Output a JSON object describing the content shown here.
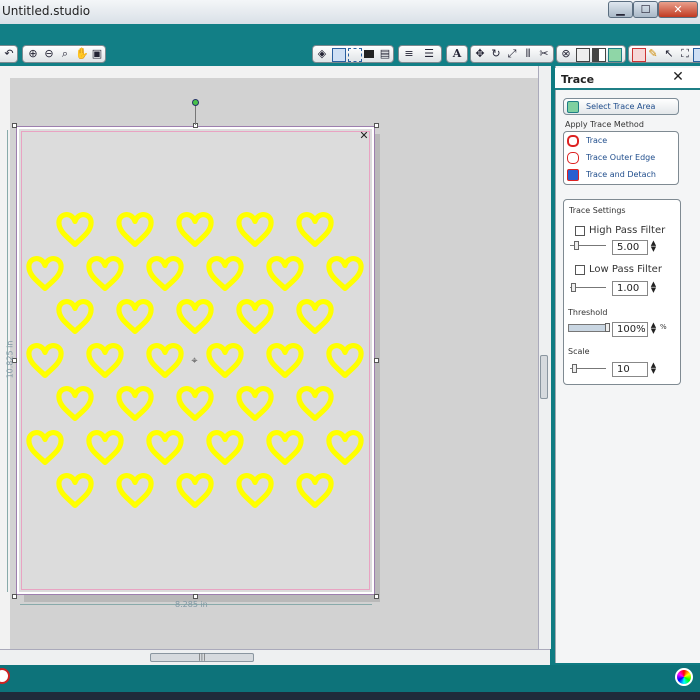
{
  "window": {
    "title": "Untitled.studio",
    "min_symbol": "▁",
    "max_symbol": "☐",
    "close_symbol": "✕"
  },
  "document": {
    "height_label": "10.825 in",
    "width_label": "8.285 in",
    "pattern_color": "#ffff00",
    "page_close_symbol": "✕",
    "center_symbol": "⌖"
  },
  "toolbar": {
    "zoom_in_icon": "⊕",
    "zoom_out_icon": "⊖",
    "zoom_select_icon": "⌕",
    "pan_icon": "✋",
    "fit_icon": "▣",
    "text_icon": "A",
    "pencil_icon": "✎",
    "cursor_icon": "↖"
  },
  "trace_panel": {
    "title": "Trace",
    "close_symbol": "✕",
    "select_trace_area_label": "Select Trace Area",
    "apply_trace_method_label": "Apply Trace Method",
    "methods": [
      {
        "label": "Trace"
      },
      {
        "label": "Trace Outer Edge"
      },
      {
        "label": "Trace and Detach"
      }
    ],
    "trace_settings_label": "Trace Settings",
    "high_pass": {
      "label": "High Pass Filter",
      "checked": false,
      "value": "5.00"
    },
    "low_pass": {
      "label": "Low Pass Filter",
      "checked": false,
      "value": "1.00"
    },
    "threshold": {
      "label": "Threshold",
      "value": "100%",
      "unit": "%",
      "level": 1.0
    },
    "scale": {
      "label": "Scale",
      "value": "10"
    },
    "accent_color": "#1f7f86"
  }
}
